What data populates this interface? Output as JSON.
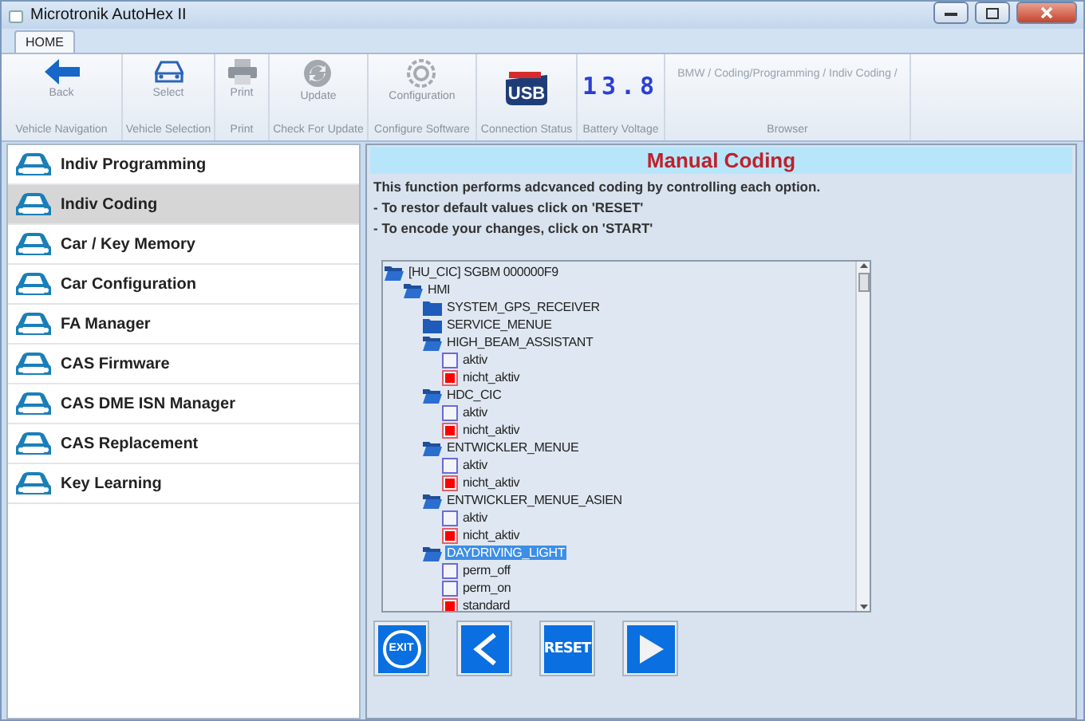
{
  "window": {
    "title": "Microtronik AutoHex II"
  },
  "tabs": [
    {
      "label": "HOME",
      "selected": true
    }
  ],
  "ribbon": [
    {
      "kind": "back",
      "label": "Back",
      "group": "Vehicle Navigation"
    },
    {
      "kind": "select",
      "label": "Select",
      "group": "Vehicle Selection"
    },
    {
      "kind": "print",
      "label": "Print",
      "group": "Print"
    },
    {
      "kind": "update",
      "label": "Update",
      "group": "Check For Update"
    },
    {
      "kind": "config",
      "label": "Configuration",
      "group": "Configure Software"
    },
    {
      "kind": "usb",
      "label": "USB",
      "group": "Connection Status"
    },
    {
      "kind": "voltage",
      "label": "13.8",
      "group": "Battery Voltage"
    },
    {
      "kind": "browser",
      "label": "BMW / Coding/Programming / Indiv Coding /",
      "group": "Browser"
    }
  ],
  "sidebar": {
    "items": [
      {
        "label": "Indiv Programming",
        "selected": false
      },
      {
        "label": "Indiv Coding",
        "selected": true
      },
      {
        "label": "Car / Key Memory",
        "selected": false
      },
      {
        "label": "Car Configuration",
        "selected": false
      },
      {
        "label": "FA Manager",
        "selected": false
      },
      {
        "label": "CAS Firmware",
        "selected": false
      },
      {
        "label": "CAS DME ISN Manager",
        "selected": false
      },
      {
        "label": "CAS Replacement",
        "selected": false
      },
      {
        "label": "Key Learning",
        "selected": false
      }
    ]
  },
  "panel": {
    "title": "Manual Coding",
    "description": [
      "This function performs adcvanced coding by controlling each option.",
      "- To restor default values click on 'RESET'",
      "- To encode your changes, click on 'START'"
    ]
  },
  "tree": [
    {
      "kind": "folder",
      "label": "[HU_CIC] SGBM 000000F9",
      "expanded": true,
      "selected": false,
      "children": [
        {
          "kind": "folder",
          "label": "HMI",
          "expanded": true,
          "selected": false,
          "children": [
            {
              "kind": "folder",
              "label": "SYSTEM_GPS_RECEIVER",
              "expanded": false,
              "selected": false
            },
            {
              "kind": "folder",
              "label": "SERVICE_MENUE",
              "expanded": false,
              "selected": false
            },
            {
              "kind": "folder",
              "label": "HIGH_BEAM_ASSISTANT",
              "expanded": true,
              "selected": false,
              "children": [
                {
                  "kind": "option",
                  "label": "aktiv",
                  "checked": false,
                  "selected": false
                },
                {
                  "kind": "option",
                  "label": "nicht_aktiv",
                  "checked": true,
                  "selected": false
                }
              ]
            },
            {
              "kind": "folder",
              "label": "HDC_CIC",
              "expanded": true,
              "selected": false,
              "children": [
                {
                  "kind": "option",
                  "label": "aktiv",
                  "checked": false,
                  "selected": false
                },
                {
                  "kind": "option",
                  "label": "nicht_aktiv",
                  "checked": true,
                  "selected": false
                }
              ]
            },
            {
              "kind": "folder",
              "label": "ENTWICKLER_MENUE",
              "expanded": true,
              "selected": false,
              "children": [
                {
                  "kind": "option",
                  "label": "aktiv",
                  "checked": false,
                  "selected": false
                },
                {
                  "kind": "option",
                  "label": "nicht_aktiv",
                  "checked": true,
                  "selected": false
                }
              ]
            },
            {
              "kind": "folder",
              "label": "ENTWICKLER_MENUE_ASIEN",
              "expanded": true,
              "selected": false,
              "children": [
                {
                  "kind": "option",
                  "label": "aktiv",
                  "checked": false,
                  "selected": false
                },
                {
                  "kind": "option",
                  "label": "nicht_aktiv",
                  "checked": true,
                  "selected": false
                }
              ]
            },
            {
              "kind": "folder",
              "label": "DAYDRIVING_LIGHT",
              "expanded": true,
              "selected": true,
              "children": [
                {
                  "kind": "option",
                  "label": "perm_off",
                  "checked": false,
                  "selected": false
                },
                {
                  "kind": "option",
                  "label": "perm_on",
                  "checked": false,
                  "selected": false
                },
                {
                  "kind": "option",
                  "label": "standard",
                  "checked": true,
                  "selected": false
                }
              ]
            }
          ]
        }
      ]
    }
  ],
  "actions": [
    {
      "kind": "exit",
      "label": "EXIT"
    },
    {
      "kind": "back"
    },
    {
      "kind": "reset",
      "label": "RESET"
    },
    {
      "kind": "start"
    }
  ]
}
